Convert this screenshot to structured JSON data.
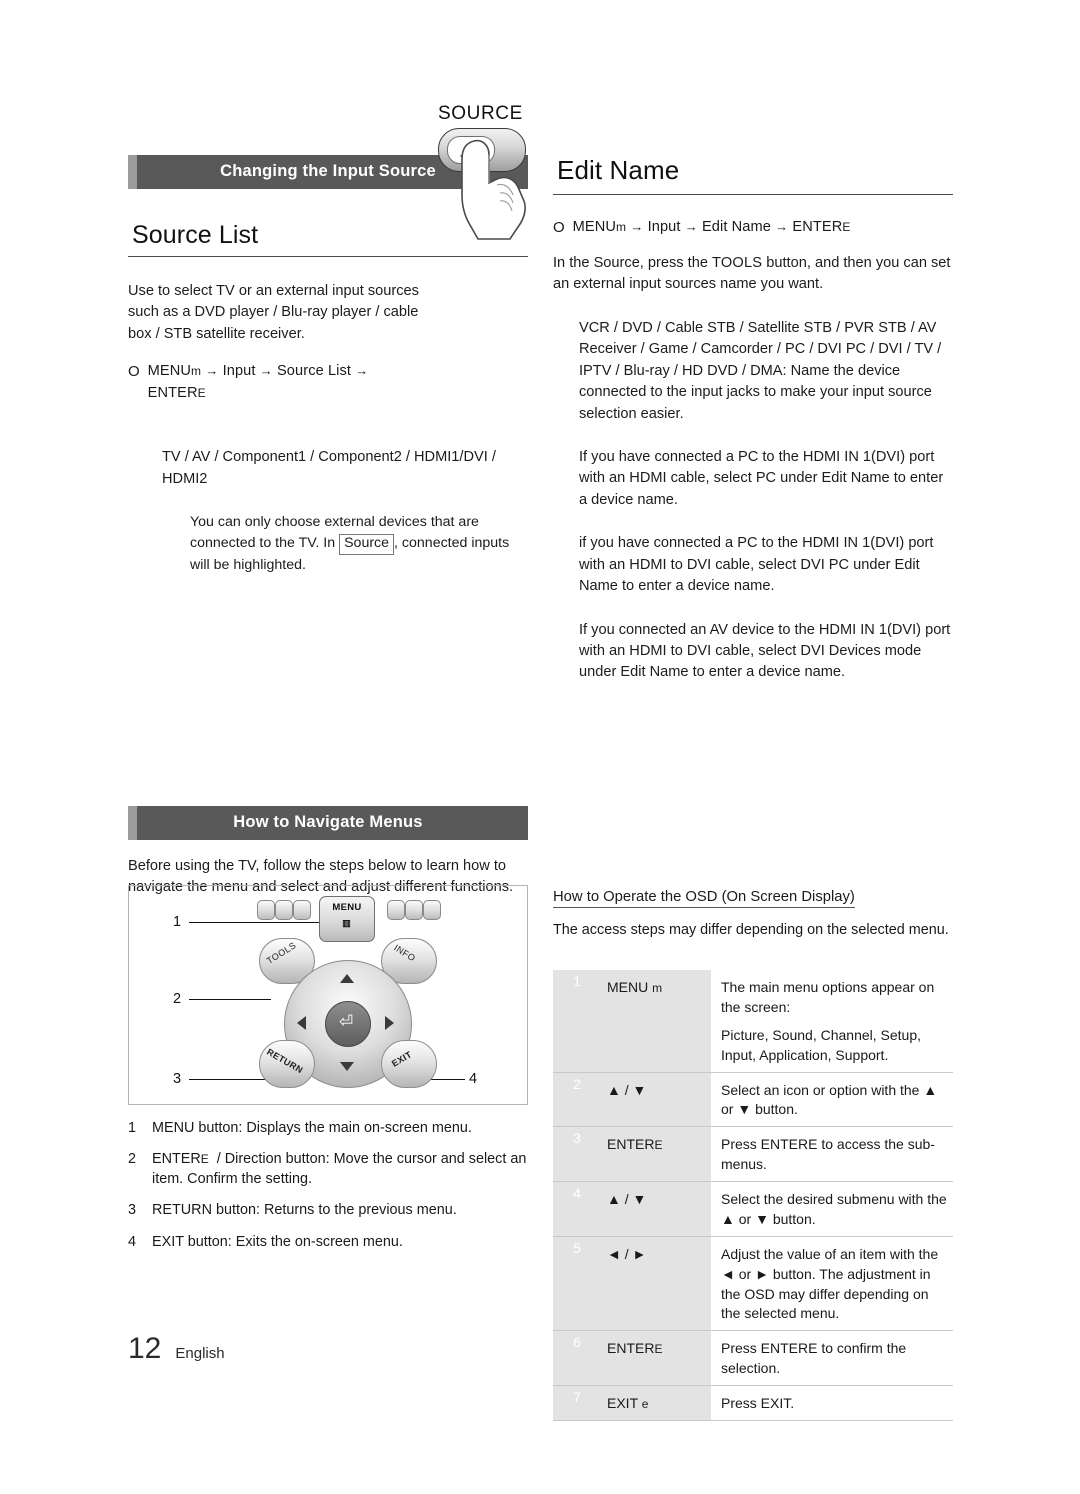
{
  "page": {
    "number": "12",
    "language": "English"
  },
  "left": {
    "section_bar": "Changing the Input Source",
    "title": "Source List",
    "intro": "Use to select TV or an external input sources such as a DVD player / Blu-ray player / cable box / STB satellite receiver.",
    "menu_path": {
      "bullet": "O",
      "menu": "MENU",
      "menu_sub": "m",
      "arrow1": "→",
      "item1": "Input",
      "arrow2": "→",
      "item2": "Source List",
      "arrow3": "→",
      "enter": "ENTER",
      "enter_sub": "E"
    },
    "source_list": "TV / AV / Component1 / Component2 / HDMI1/DVI / HDMI2",
    "note": "You can only choose external devices that are connected to the TV. In Source , connected inputs will be highlighted.",
    "note_boxed": "Source",
    "source_button_label": "SOURCE"
  },
  "right": {
    "title": "Edit Name",
    "menu_path": {
      "bullet": "O",
      "menu": "MENU",
      "menu_sub": "m",
      "arrow1": "→",
      "item1": "Input",
      "arrow2": "→",
      "item2": "Edit Name",
      "arrow3": "→",
      "enter": "ENTER",
      "enter_sub": "E"
    },
    "intro": "In the Source, press the TOOLS button, and then you can set an external input sources name you want.",
    "intro_kw": "TOOLS",
    "device_list": "VCR / DVD / Cable STB / Satellite STB / PVR STB / AV Receiver / Game / Camcorder / PC / DVI PC / DVI / TV / IPTV / Blu-ray / HD DVD / DMA: Name the device connected to the input jacks to make your input source selection easier.",
    "para_pc": "If you have connected a PC to the HDMI IN 1(DVI) port with an HDMI cable, select PC under Edit Name to enter a device name.",
    "para_dvipc": "if you have connected a PC to the HDMI IN 1(DVI) port with an HDMI to DVI cable, select DVI PC under Edit Name to enter a device name.",
    "para_av": "If you connected an AV device to the HDMI IN 1(DVI) port with an HDMI to DVI cable, select DVI Devices mode under Edit Name to enter a device name."
  },
  "navigate": {
    "section_bar": "How to Navigate Menus",
    "intro": "Before using the TV, follow the steps below to learn how to navigate the menu and select and adjust different functions.",
    "callouts": [
      "1",
      "2",
      "3",
      "4"
    ],
    "remote_keys": {
      "menu": "MENU",
      "tools": "TOOLS",
      "info": "INFO",
      "return": "RETURN",
      "exit": "EXIT"
    },
    "list": [
      {
        "n": "1",
        "text": "MENU button: Displays the main on-screen menu."
      },
      {
        "n": "2",
        "text": "ENTERE / Direction button: Move the cursor and select an item. Confirm the setting.",
        "kw": "ENTER",
        "kw_sub": "E"
      },
      {
        "n": "3",
        "text": "RETURN button: Returns to the previous menu."
      },
      {
        "n": "4",
        "text": "EXIT button: Exits the on-screen menu."
      }
    ]
  },
  "osd": {
    "heading": "How to Operate the OSD (On Screen Display)",
    "intro": "The access steps may differ depending on the selected menu.",
    "rows": [
      {
        "num": "1",
        "key": "MENU m",
        "key_main": "MENU",
        "key_sub": "m",
        "desc": "The main menu options appear on the screen:",
        "desc2": "Picture, Sound, Channel, Setup, Input, Application, Support."
      },
      {
        "num": "2",
        "key": "▲ / ▼",
        "key_main": "▲ / ▼",
        "key_sub": "",
        "desc": "Select an icon or option with the ▲ or ▼ button.",
        "desc2": ""
      },
      {
        "num": "3",
        "key": "ENTER E",
        "key_main": "ENTER",
        "key_sub": "E",
        "desc": "Press ENTERE to access the sub-menus.",
        "desc2": ""
      },
      {
        "num": "4",
        "key": "▲ / ▼",
        "key_main": "▲ / ▼",
        "key_sub": "",
        "desc": "Select the desired submenu with the ▲ or ▼ button.",
        "desc2": ""
      },
      {
        "num": "5",
        "key": "◄ / ►",
        "key_main": "◄ / ►",
        "key_sub": "",
        "desc": "Adjust the value of an item with the ◄ or ► button. The adjustment in the OSD may differ depending on the selected menu.",
        "desc2": ""
      },
      {
        "num": "6",
        "key": "ENTER E",
        "key_main": "ENTER",
        "key_sub": "E",
        "desc": "Press ENTERE to confirm the selection.",
        "desc2": ""
      },
      {
        "num": "7",
        "key": "EXIT e",
        "key_main": "EXIT",
        "key_sub": "e",
        "desc": "Press EXIT.",
        "desc2": ""
      }
    ]
  }
}
